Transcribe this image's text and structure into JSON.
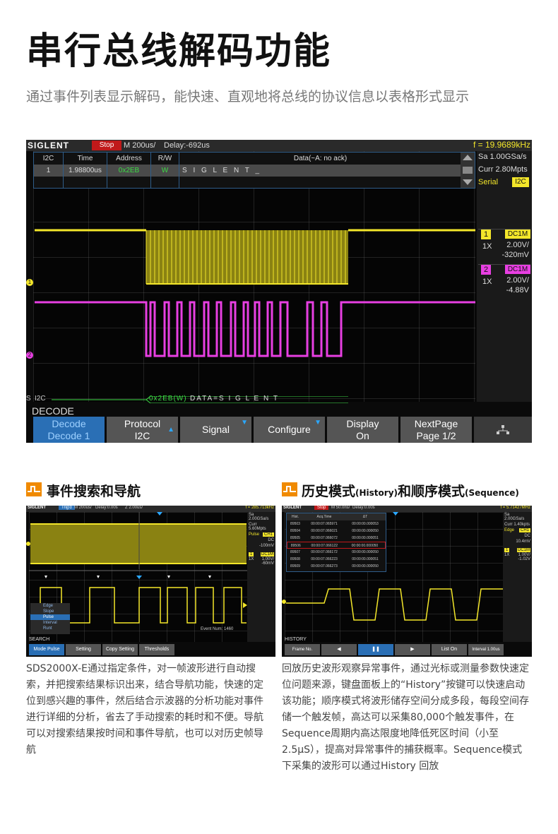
{
  "page": {
    "title": "串行总线解码功能",
    "subtitle": "通过事件列表显示解码，能快速、直观地将总线的协议信息以表格形式显示"
  },
  "main_scope": {
    "logo": "SIGLENT",
    "status": "Stop",
    "timebase": "M 200us/",
    "delay": "Delay:-692us",
    "frequency": "f = 19.9689kHz",
    "table": {
      "headers": [
        "I2C",
        "Time",
        "Address",
        "R/W",
        "Data(~A: no ack)"
      ],
      "rows": [
        [
          "1",
          "1.98800us",
          "0x2EB",
          "W",
          "S I G L E N T _"
        ]
      ]
    },
    "right_panel": {
      "sample_rate": "Sa 1.00GSa/s",
      "curr": "Curr 2.80Mpts",
      "serial_label": "Serial",
      "serial_badge": "I2C",
      "ch1": {
        "num": "1",
        "coupling": "DC1M",
        "probe": "1X",
        "volts": "2.00V/",
        "offset": "-320mV"
      },
      "ch2": {
        "num": "2",
        "coupling": "DC1M",
        "probe": "1X",
        "volts": "2.00V/",
        "offset": "-4.88V"
      }
    },
    "markers": {
      "ch1": "1",
      "ch2": "2"
    },
    "bus": {
      "prefix": "S",
      "name": "I2C",
      "addr": "0x2EB(W)",
      "data": "DATA=S I G L E N T"
    },
    "menu_label": "DECODE",
    "softkeys": [
      {
        "line1": "Decode",
        "line2": "Decode 1"
      },
      {
        "line1": "Protocol",
        "line2": "I2C"
      },
      {
        "line1": "Signal",
        "line2": ""
      },
      {
        "line1": "Configure",
        "line2": ""
      },
      {
        "line1": "Display",
        "line2": "On"
      },
      {
        "line1": "NextPage",
        "line2": "Page 1/2"
      }
    ]
  },
  "section_left": {
    "title": "事件搜索和导航",
    "scope": {
      "logo": "SIGLENT",
      "status": "Trig'd",
      "timebase": "M 200us/",
      "delay": "Delay:0.00s",
      "zoom": "Z 2.00us/",
      "frequency": "f = 285.713kHz",
      "sa": "Sa 2.00GSa/s",
      "curr": "Curr 5.60Mpts",
      "trigger": "Pulse",
      "trigger_ch": "CH1",
      "coupling": "DC",
      "level": "-100mV",
      "ch_num": "1",
      "ch_coupling": "DC1M",
      "ch_probe": "1X",
      "ch_volts": "1.00V/",
      "ch_offset": "-60mV",
      "event_num": "Event Num: 1460",
      "menu_items": [
        "Edge",
        "Slope",
        "Pulse",
        "Interval",
        "Runt"
      ],
      "menu_label": "SEARCH",
      "softkeys": [
        "Mode Pulse",
        "Setting",
        "Copy Setting",
        "Thresholds"
      ]
    },
    "description": "SDS2000X-E通过指定条件，对一帧波形进行自动搜索，并把搜索结果标识出来，结合导航功能，快速的定位到感兴趣的事件，然后结合示波器的分析功能对事件进行详细的分析，省去了手动搜索的耗时和不便。导航可以对搜索结果按时间和事件导航，也可以对历史帧导航"
  },
  "section_right": {
    "title": "历史模式",
    "title_small_1": "(History)",
    "title_mid": "和顺序模式",
    "title_small_2": "(Sequence)",
    "scope": {
      "logo": "SIGLENT",
      "status": "Stop",
      "timebase": "M 50.0ns/",
      "delay": "Delay:0.00s",
      "frequency": "f = 5.71427MHz",
      "sa": "Sa 2.00GSa/s",
      "curr": "Curr 1.40kpts",
      "trigger": "Edge",
      "trigger_ch": "CH1",
      "coupling": "DC",
      "level": "10.4mV",
      "ch_num": "1",
      "ch_coupling": "DC1M",
      "ch_probe": "1X",
      "ch_volts": "1.00V/",
      "ch_offset": "-1.02V",
      "table_headers": [
        "Hist.",
        "Acq.Time",
        "ΔT"
      ],
      "table_rows": [
        [
          "89503",
          "00:00:07.065971",
          "00:00:00.000053"
        ],
        [
          "89504",
          "00:00:07.066021",
          "00:00:00.000050"
        ],
        [
          "89505",
          "00:00:07.066072",
          "00:00:00.000051"
        ],
        [
          "89506",
          "00:00:07.066122",
          "00:00:00.000050"
        ],
        [
          "89507",
          "00:00:07.066172",
          "00:00:00.000050"
        ],
        [
          "89508",
          "00:00:07.066223",
          "00:00:00.000051"
        ],
        [
          "89509",
          "00:00:07.066273",
          "00:00:00.000050"
        ]
      ],
      "menu_label": "HISTORY",
      "softkeys": [
        "Frame No. 1605/29140",
        "◀",
        "❚❚",
        "▶",
        "List On",
        "Interval 1.00us"
      ]
    },
    "description": "回放历史波形观察异常事件，通过光标或测量参数快速定位问题来源，键盘面板上的“History”按键可以快速启动该功能；顺序模式将波形储存空间分成多段，每段空间存储一个触发帧，高达可以采集80,000个触发事件，在Sequence周期内高达限度地降低死区时间（小至2.5μS），提高对异常事件的捕获概率。Sequence模式下采集的波形可以通过History 回放"
  },
  "colors": {
    "ch1": "#f3e62a",
    "ch2": "#e83fe2",
    "accent": "#f08a00",
    "active_key": "#2a6fb5"
  }
}
